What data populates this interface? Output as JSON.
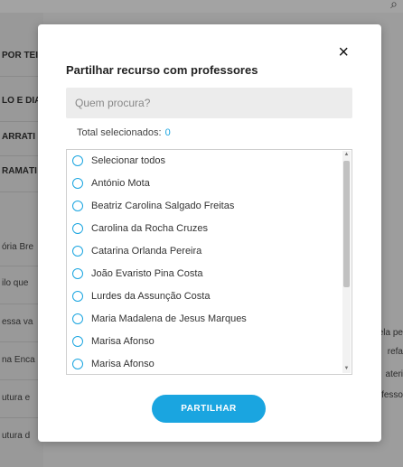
{
  "background": {
    "left_items": [
      "POR TEI",
      "LO E DIA",
      "ARRATI",
      "RAMÁTI",
      "ória Bre",
      "ilo que",
      "essa va",
      "na Enca",
      "utura e",
      "utura d"
    ],
    "right_items": [
      "ela pe",
      "refa",
      "ateri",
      "fesso"
    ]
  },
  "modal": {
    "title": "Partilhar recurso com professores",
    "close_icon": "×",
    "search_placeholder": "Quem procura?",
    "total_label": "Total selecionados:",
    "total_count": "0",
    "items": [
      "Selecionar todos",
      "António Mota",
      "Beatriz Carolina Salgado Freitas",
      "Carolina da Rocha Cruzes",
      "Catarina Orlanda Pereira",
      "João Evaristo Pina Costa",
      "Lurdes da Assunção Costa",
      "Maria Madalena de Jesus Marques",
      "Marisa Afonso",
      "Marisa Afonso"
    ],
    "share_label": "PARTILHAR"
  },
  "colors": {
    "accent": "#1aa5e0",
    "overlay": "rgba(0,0,0,0.36)"
  }
}
